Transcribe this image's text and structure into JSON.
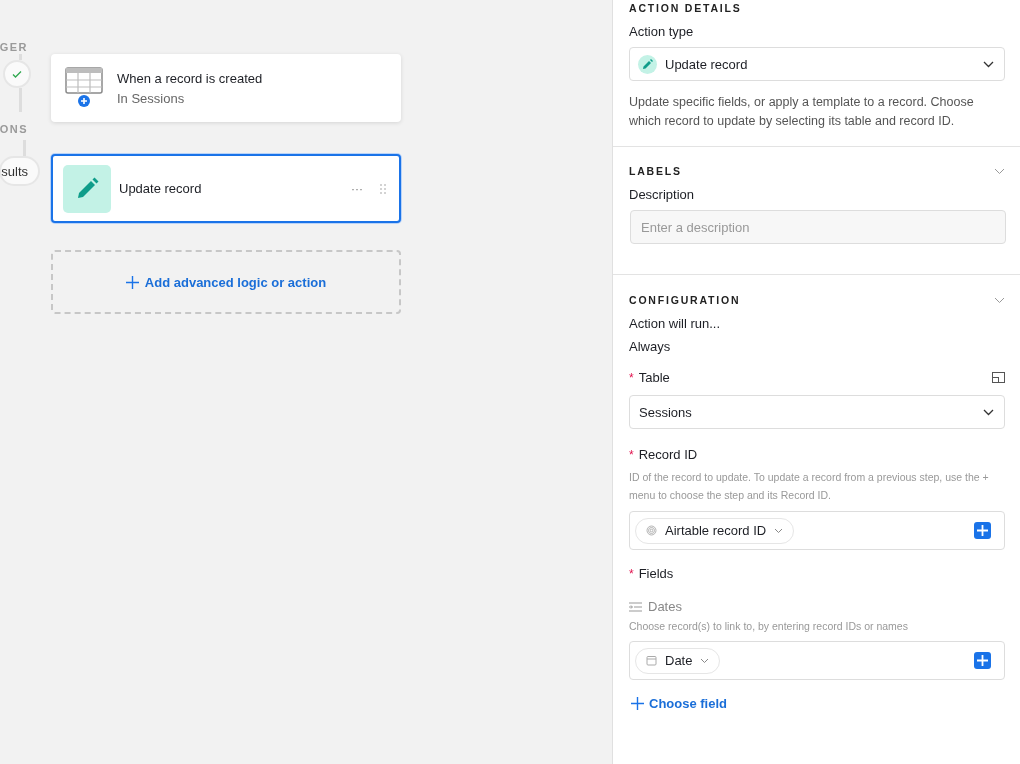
{
  "canvas": {
    "trigger_label": "GER",
    "trigger": {
      "title": "When a record is created",
      "subtitle": "In Sessions",
      "done": true
    },
    "actions_label": "ONS",
    "results_button": "sults",
    "action": {
      "title": "Update record",
      "selected": true,
      "more": "···"
    },
    "add_button": "Add advanced logic or action"
  },
  "panel": {
    "section_title": "ACTION DETAILS",
    "action_type_label": "Action type",
    "action_type_value": "Update record",
    "action_description": "Update specific fields, or apply a template to a record. Choose which record to update by selecting its table and record ID.",
    "labels_section": {
      "title": "LABELS",
      "expanded": true,
      "description_label": "Description",
      "description_placeholder": "Enter a description"
    },
    "configuration_section": {
      "title": "CONFIGURATION",
      "expanded": true,
      "run_label": "Action will run...",
      "run_value": "Always",
      "table_label": "Table",
      "table_required_mark": "*",
      "table_value": "Sessions",
      "record_id_label": "Record ID",
      "record_id_required_mark": "*",
      "record_id_help": "ID of the record to update. To update a record from a previous step, use the + menu to choose the step and its Record ID.",
      "record_id_token": "Airtable record ID",
      "fields_label": "Fields",
      "fields_required_mark": "*",
      "field_name": "Dates",
      "field_help": "Choose record(s) to link to, by entering record IDs or names",
      "field_token": "Date",
      "choose_field": "Choose field"
    }
  }
}
